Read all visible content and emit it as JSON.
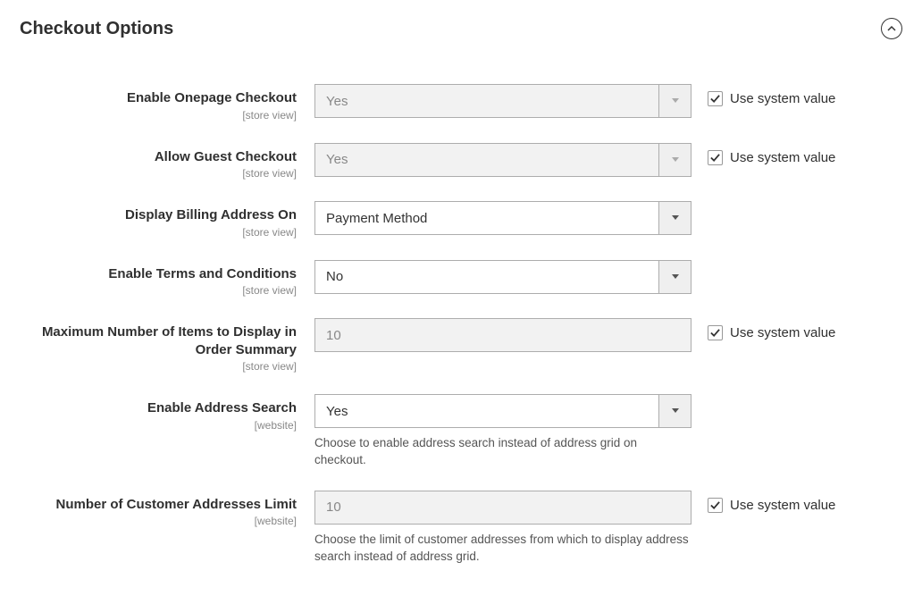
{
  "section": {
    "title": "Checkout Options"
  },
  "rows": {
    "onepage": {
      "label": "Enable Onepage Checkout",
      "scope": "[store view]",
      "value": "Yes",
      "sysval_label": "Use system value"
    },
    "guest": {
      "label": "Allow Guest Checkout",
      "scope": "[store view]",
      "value": "Yes",
      "sysval_label": "Use system value"
    },
    "billing": {
      "label": "Display Billing Address On",
      "scope": "[store view]",
      "value": "Payment Method"
    },
    "terms": {
      "label": "Enable Terms and Conditions",
      "scope": "[store view]",
      "value": "No"
    },
    "maxitems": {
      "label": "Maximum Number of Items to Display in Order Summary",
      "scope": "[store view]",
      "value": "10",
      "sysval_label": "Use system value"
    },
    "addrsearch": {
      "label": "Enable Address Search",
      "scope": "[website]",
      "value": "Yes",
      "helper": "Choose to enable address search instead of address grid on checkout."
    },
    "addrlimit": {
      "label": "Number of Customer Addresses Limit",
      "scope": "[website]",
      "value": "10",
      "helper": "Choose the limit of customer addresses from which to display address search instead of address grid.",
      "sysval_label": "Use system value"
    }
  }
}
